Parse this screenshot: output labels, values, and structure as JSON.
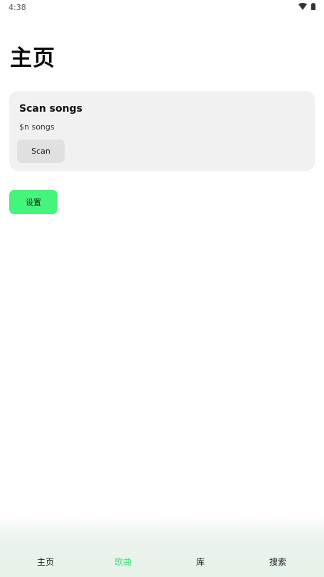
{
  "status_bar": {
    "time": "4:38",
    "icons": [
      "wifi-icon",
      "battery-icon"
    ]
  },
  "page": {
    "title": "主页"
  },
  "scan_card": {
    "title": "Scan songs",
    "subtitle": "$n songs",
    "button_label": "Scan"
  },
  "settings_button": {
    "label": "设置"
  },
  "bottom_nav": {
    "items": [
      {
        "label": "主页",
        "active": false
      },
      {
        "label": "歌曲",
        "active": true
      },
      {
        "label": "库",
        "active": false
      },
      {
        "label": "搜索",
        "active": false
      }
    ]
  },
  "colors": {
    "accent": "#45f57b",
    "active_nav": "#43e27a",
    "card_background": "#f1f1f1",
    "secondary_button": "#e0e0e0"
  }
}
